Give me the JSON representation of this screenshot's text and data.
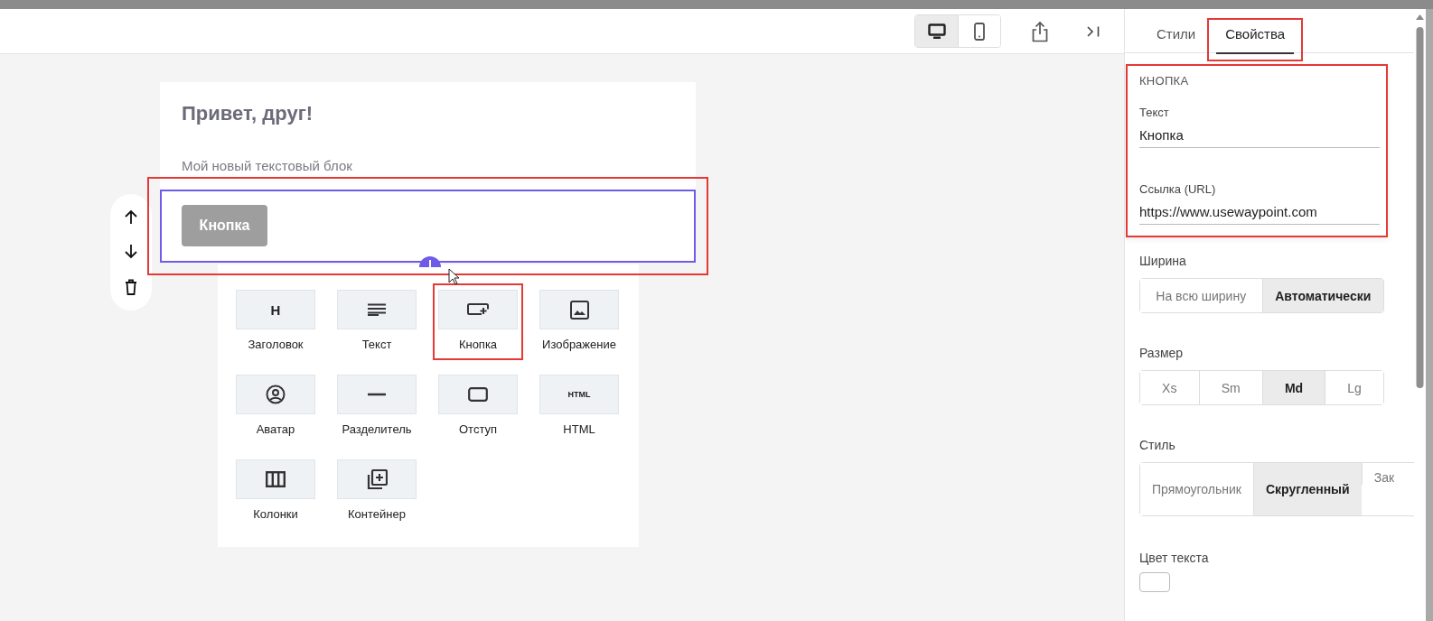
{
  "toolbar": {
    "views": [
      {
        "kind": "desktop",
        "selected": true
      },
      {
        "kind": "mobile",
        "selected": false
      }
    ]
  },
  "panel_tabs": [
    {
      "label": "Стили",
      "selected": false,
      "highlighted": false
    },
    {
      "label": "Свойства",
      "selected": true,
      "highlighted": true
    }
  ],
  "canvas": {
    "heading": "Привет, друг!",
    "paragraph": "Мой новый текстовый блок",
    "button": {
      "label": "Кнопка"
    },
    "selected_block": {
      "highlighted": true
    }
  },
  "block_picker": [
    {
      "kind": "heading",
      "icon_text": "H",
      "label": "Заголовок",
      "highlighted": false
    },
    {
      "kind": "text",
      "label": "Текст",
      "highlighted": false
    },
    {
      "kind": "button",
      "label": "Кнопка",
      "highlighted": true
    },
    {
      "kind": "image",
      "label": "Изображение",
      "highlighted": false
    },
    {
      "kind": "avatar",
      "label": "Аватар",
      "highlighted": false
    },
    {
      "kind": "divider",
      "label": "Разделитель",
      "highlighted": false
    },
    {
      "kind": "spacer",
      "label": "Отступ",
      "highlighted": false
    },
    {
      "kind": "html",
      "icon_text": "HTML",
      "label": "HTML",
      "highlighted": false
    },
    {
      "kind": "columns",
      "label": "Колонки",
      "highlighted": false
    },
    {
      "kind": "container",
      "label": "Контейнер",
      "highlighted": false
    }
  ],
  "properties": {
    "section_title": "КНОПКА",
    "highlighted": true,
    "fields": [
      {
        "label": "Текст",
        "value": "Кнопка"
      },
      {
        "label": "Ссылка (URL)",
        "value": "https://www.usewaypoint.com"
      }
    ],
    "groups": [
      {
        "label": "Ширина",
        "options": [
          {
            "label": "На всю ширину",
            "selected": false
          },
          {
            "label": "Автоматически",
            "selected": true
          }
        ]
      },
      {
        "label": "Размер",
        "options": [
          {
            "label": "Xs",
            "selected": false
          },
          {
            "label": "Sm",
            "selected": false
          },
          {
            "label": "Md",
            "selected": true
          },
          {
            "label": "Lg",
            "selected": false
          }
        ]
      },
      {
        "label": "Стиль",
        "options": [
          {
            "label": "Прямоугольник",
            "selected": false
          },
          {
            "label": "Скругленный",
            "selected": true
          },
          {
            "label": "Зак",
            "selected": false
          }
        ]
      }
    ],
    "text_color": {
      "label": "Цвет текста"
    }
  }
}
